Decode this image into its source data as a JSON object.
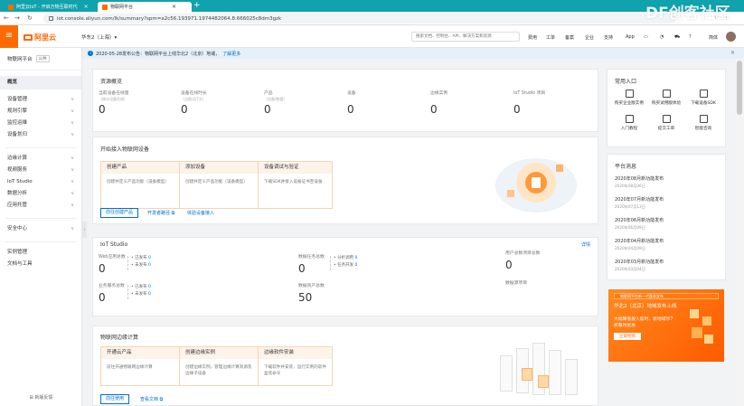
{
  "browser": {
    "tabs": [
      {
        "title": "阿里云IoT - 开启万物互联时代"
      },
      {
        "title": "物联网平台"
      }
    ],
    "url": "iot.console.aliyun.com/lk/summary?spm=a2c56.193971.1974482064.8.666025c8dm3gzk",
    "watermark": "DF创客社区"
  },
  "topnav": {
    "logo": "阿里云",
    "region": "华东2（上海）▾",
    "search_placeholder": "搜索文档、控制台、API、解决方案和资源",
    "items": [
      "费用",
      "工单",
      "备案",
      "企业",
      "支持",
      "App"
    ],
    "lang": "简体"
  },
  "sidebar": {
    "title": "物联网平台",
    "badge": "公共",
    "items": [
      {
        "label": "概览",
        "chev": ""
      },
      {
        "label": "设备管理",
        "chev": "∨"
      },
      {
        "label": "规则引擎",
        "chev": "∨"
      },
      {
        "label": "监控运维",
        "chev": "∨"
      },
      {
        "label": "设备划归",
        "chev": "∨"
      },
      {
        "label": "边缘计算",
        "chev": "∨"
      },
      {
        "label": "视频服务",
        "chev": "∨"
      },
      {
        "label": "IoT Studio",
        "chev": "∨"
      },
      {
        "label": "数据分析",
        "chev": "∨"
      },
      {
        "label": "应用托管",
        "chev": "∨"
      },
      {
        "label": "安全中心",
        "chev": "∨"
      },
      {
        "label": "实例管理",
        "chev": ""
      },
      {
        "label": "文档与工具",
        "chev": ""
      }
    ],
    "footer": "新版反馈"
  },
  "notice": {
    "text": "2020-05-28发布公告：物联网平台上线华北2（北京）地域，",
    "link": "了解更多"
  },
  "overview": {
    "title": "资源概览",
    "stats": [
      {
        "label": "当前设备在线量",
        "sub": "（统计设备在线）",
        "value": "0"
      },
      {
        "label": "设备在线时长",
        "sub": "（当前/近7天）",
        "value": "0"
      },
      {
        "label": "产品",
        "sub": "（设备/数据）",
        "value": "0"
      },
      {
        "label": "设备",
        "sub": "",
        "value": "0"
      },
      {
        "label": "边缘实例",
        "sub": "",
        "value": "0"
      },
      {
        "label": "IoT Studio 项目",
        "sub": "",
        "value": "0"
      }
    ]
  },
  "quickstart": {
    "title": "开始接入物联网设备",
    "steps": [
      {
        "title": "创建产品",
        "desc": "创建并定义产品功能（设备模型）"
      },
      {
        "title": "添加设备",
        "desc": "创建并定义产品功能（设备模型）"
      },
      {
        "title": "设备调试与验证",
        "desc": "下载SDK并接入设备证书至设备"
      }
    ],
    "btn": "前往创建产品",
    "link1": "开发者路径 ⧉",
    "link2": "体验设备接入"
  },
  "iotstudio": {
    "title": "IoT Studio",
    "more": "详情",
    "web": {
      "label": "Web应用总数",
      "value": "0",
      "a": "已发布",
      "av": "0",
      "b": "未发布",
      "bv": "0"
    },
    "service": {
      "label": "业务服务总数",
      "value": "0",
      "a": "已发布",
      "av": "0",
      "b": "未发布",
      "bv": "0"
    },
    "task": {
      "label": "数据任务总数",
      "value": "0",
      "a": "分析调用",
      "av": "0",
      "b": "任务开发",
      "bv": "0"
    },
    "asset": {
      "label": "数据资产总数",
      "value": "50"
    },
    "user": {
      "label": "用户总数项目总数",
      "value": "0"
    },
    "datasrc": {
      "label": "数据源项目"
    }
  },
  "edge": {
    "title": "物联网边缘计算",
    "steps": [
      {
        "title": "开通云产品",
        "desc": "前往开通物联网边缘计算"
      },
      {
        "title": "创建边缘实例",
        "desc": "创建边缘实例，管理边缘计算资源及边缘子设备"
      },
      {
        "title": "边缘软件安装",
        "desc": "下载软件并安装，运行实例的软件盒装命令"
      }
    ],
    "btn": "前往使用",
    "link": "查看文档 ⧉"
  },
  "quickaccess": {
    "title": "常用入口",
    "items": [
      {
        "label": "购买企业版实例"
      },
      {
        "label": "购买试用版体验"
      },
      {
        "label": "下载设备SDK"
      },
      {
        "label": "入门教程"
      },
      {
        "label": "提交工单"
      },
      {
        "label": "智能咨询"
      }
    ]
  },
  "news": {
    "title": "平台消息",
    "items": [
      {
        "title": "2020年08月新功能发布",
        "date": "2020年08月06日"
      },
      {
        "title": "2020年07月新功能发布",
        "date": "2020年07月13日"
      },
      {
        "title": "2020年06月新功能发布",
        "date": "2020年06月09日"
      },
      {
        "title": "2020年04月新功能发布",
        "date": "2020年04月09日"
      },
      {
        "title": "2020年03月新功能发布",
        "date": "2020年03月04日"
      }
    ]
  },
  "promo": {
    "bar": "物联网平台新一代版本发布",
    "line1": "华北2（北京）地域发布上线",
    "line2": "大幅降低接入延时，新地域享7折限时优惠",
    "btn": "立即抢购"
  }
}
